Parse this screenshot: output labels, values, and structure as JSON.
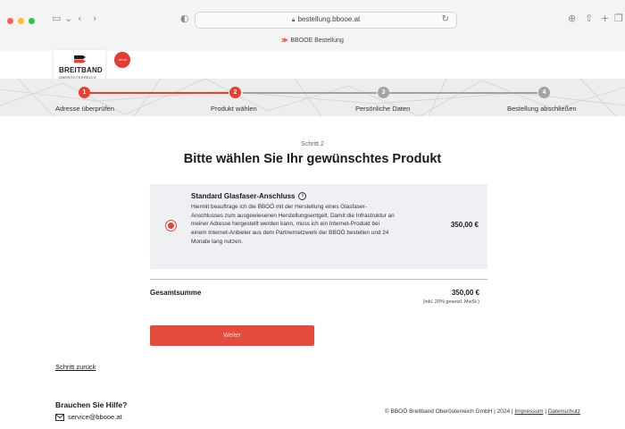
{
  "browser": {
    "url": "bestellung.bbooe.at",
    "tab_title": "BBOOE Bestellung",
    "tab_logo": "≫"
  },
  "header": {
    "logo_text": "BREITBAND",
    "logo_sub": "OBERÖSTERREICH",
    "badge_text": "oö·at"
  },
  "steps": [
    {
      "number": "1",
      "label": "Adresse überprüfen",
      "state": "active"
    },
    {
      "number": "2",
      "label": "Produkt wählen",
      "state": "active"
    },
    {
      "number": "3",
      "label": "Persönliche Daten",
      "state": "inactive"
    },
    {
      "number": "4",
      "label": "Bestellung abschließen",
      "state": "inactive"
    }
  ],
  "main": {
    "step_label": "Schritt 2",
    "title": "Bitte wählen Sie Ihr gewünschtes Produkt",
    "product": {
      "title": "Standard Glasfaser-Anschluss",
      "info_icon": "i",
      "description": "Hiermit beauftrage ich die BBOÖ mit der Herstellung eines Glasfaser-Anschlusses zum ausgewiesenen Herstellungsentgelt. Damit die Infrastruktur an meiner Adresse hergestellt werden kann, muss ich ein Internet-Produkt bei einem Internet-Anbieter aus dem Partnernetzwerk der BBOÖ bestellen und 24 Monate lang nutzen.",
      "price": "350,00 €",
      "selected": true
    },
    "total_label": "Gesamtsumme",
    "total_value": "350,00 €",
    "total_note": "(inkl. 20% gesetzl. MwSt.)",
    "next_button": "Weiter",
    "back_link": "Schritt zurück"
  },
  "footer": {
    "help_title": "Brauchen Sie Hilfe?",
    "email": "service@bbooe.at",
    "copyright": "© BBOÖ Breitband Oberösterreich GmbH | 2024 |",
    "imprint": "Impressum",
    "separator": "|",
    "privacy": "Datenschutz"
  },
  "colors": {
    "accent": "#e83f33",
    "inactive": "#a3a3a3",
    "card_bg": "#eef0f3"
  }
}
